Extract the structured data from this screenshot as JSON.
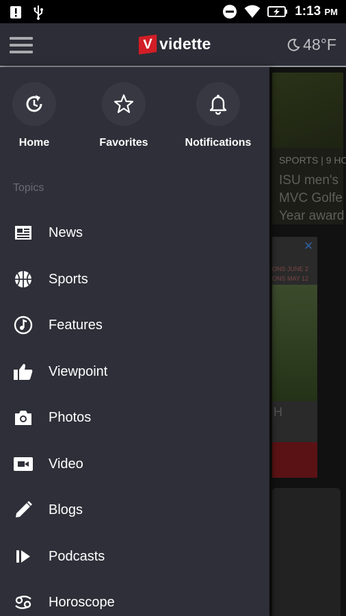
{
  "status_bar": {
    "time": "1:13",
    "ampm": "PM"
  },
  "app_bar": {
    "logo_text": "vidette",
    "logo_mark": "V",
    "temperature": "48°F"
  },
  "drawer": {
    "quick_links": [
      {
        "label": "Home",
        "icon": "home-refresh-icon"
      },
      {
        "label": "Favorites",
        "icon": "star-icon"
      },
      {
        "label": "Notifications",
        "icon": "bell-icon"
      }
    ],
    "topics_title": "Topics",
    "topics": [
      {
        "label": "News",
        "icon": "newspaper-icon"
      },
      {
        "label": "Sports",
        "icon": "basketball-icon"
      },
      {
        "label": "Features",
        "icon": "music-note-icon"
      },
      {
        "label": "Viewpoint",
        "icon": "thumbs-up-icon"
      },
      {
        "label": "Photos",
        "icon": "camera-icon"
      },
      {
        "label": "Video",
        "icon": "video-camera-icon"
      },
      {
        "label": "Blogs",
        "icon": "pencil-icon"
      },
      {
        "label": "Podcasts",
        "icon": "podcast-play-icon"
      },
      {
        "label": "Horoscope",
        "icon": "cancer-zodiac-icon"
      }
    ]
  },
  "background": {
    "article_meta": "SPORTS | 9 HO",
    "article_headline": [
      "ISU men's",
      "MVC Golfe",
      "Year award"
    ],
    "ad_text": "ONS JUNE 2",
    "ad_text2": "ONS MAY 12",
    "ad_letter": "H"
  },
  "colors": {
    "drawer_bg": "#2f2f39",
    "appbar_bg": "#2c2d36",
    "brand_red": "#d21e26"
  }
}
